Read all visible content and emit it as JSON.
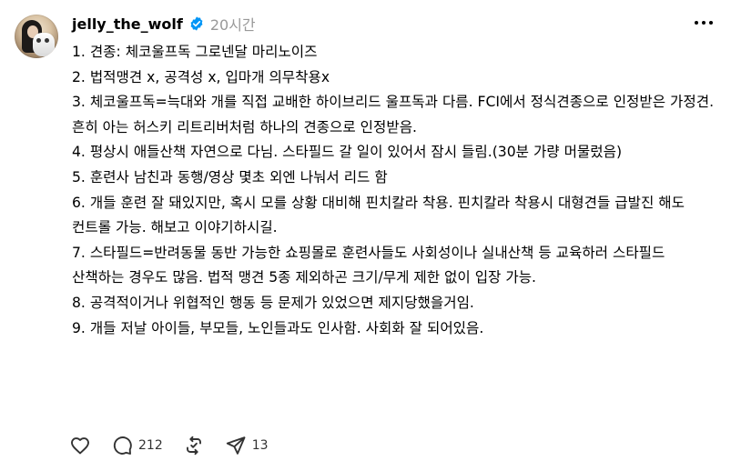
{
  "post": {
    "username": "jelly_the_wolf",
    "time": "20시간",
    "lines": [
      "1. 견종: 체코울프독 그로넨달 마리노이즈",
      "2. 법적맹견 x, 공격성 x, 입마개 의무착용x",
      "3. 체코울프독=늑대와 개를 직접 교배한 하이브리드 울프독과 다름. FCI에서 정식견종으로 인정받은 가정견. 흔히 아는 허스키 리트리버처럼 하나의 견종으로 인정받음.",
      "4. 평상시 애들산책 자연으로 다님. 스타필드 갈 일이 있어서 잠시 들림.(30분 가량 머물렀음)",
      "5. 훈련사 남친과 동행/영상 몇초 외엔 나눠서 리드 함",
      "6. 개들 훈련 잘 돼있지만, 혹시 모를 상황 대비해 핀치칼라 착용. 핀치칼라 착용시 대형견들 급발진 해도 컨트롤 가능. 해보고 이야기하시길.",
      "7. 스타필드=반려동물 동반 가능한 쇼핑몰로 훈련사들도 사회성이나 실내산책 등 교육하러 스타필드 산책하는 경우도 많음. 법적 맹견 5종 제외하곤 크기/무게 제한 없이 입장 가능.",
      "8. 공격적이거나 위협적인 행동 등 문제가 있었으면 제지당했을거임.",
      "9. 개들 저날 아이들, 부모들, 노인들과도 인사함. 사회화 잘 되어있음."
    ]
  },
  "actions": {
    "comment_count": "212",
    "share_count": "13"
  },
  "icons": {
    "verified": "verified-badge-icon",
    "like": "heart-icon",
    "comment": "comment-bubble-icon",
    "repost": "repost-icon",
    "share": "send-icon",
    "more": "more-icon"
  },
  "colors": {
    "verified": "#0095f6",
    "muted": "#999999"
  }
}
